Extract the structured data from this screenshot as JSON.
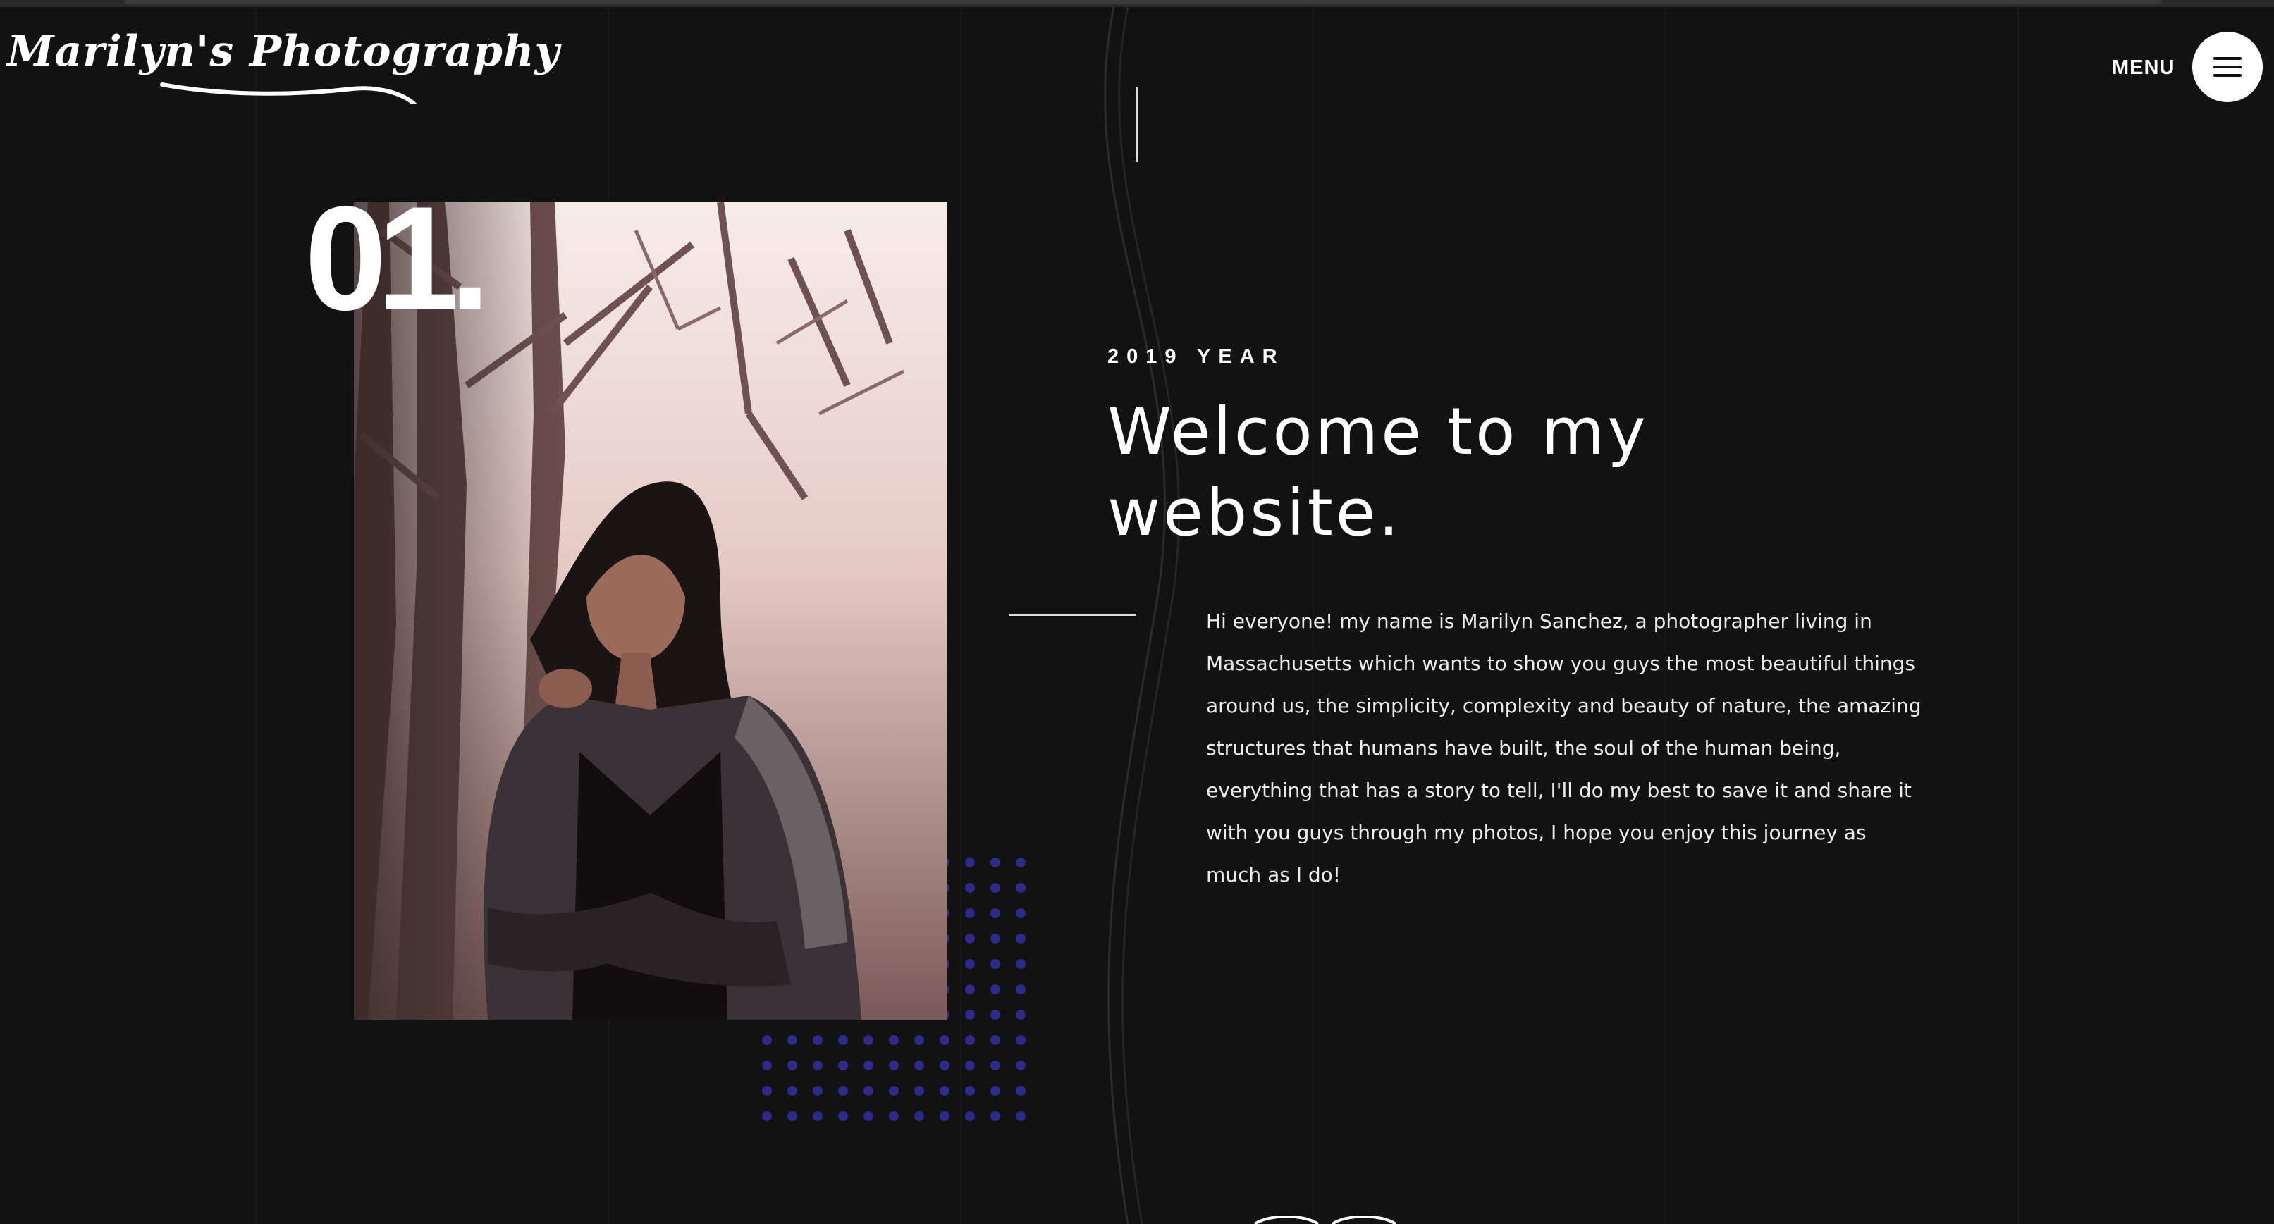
{
  "header": {
    "logo_text": "Marilyn's Photography",
    "menu_label": "MENU"
  },
  "section": {
    "number": "01.",
    "year_label": "2019 YEAR",
    "headline": "Welcome to my website.",
    "intro": "Hi everyone! my name is Marilyn Sanchez, a photographer living in Massachusetts which wants to show you guys the most beautiful things around us, the simplicity, complexity and beauty of nature, the amazing structures that humans have built, the soul of the human being, everything that has a story to tell, I'll do my best to save it and share it with you guys through my photos, I hope you enjoy this journey as much as I do!"
  },
  "colors": {
    "background": "#121212",
    "text": "#ffffff",
    "dot_accent": "#2e2a8c",
    "menu_button": "#ffffff"
  },
  "icons": {
    "menu": "hamburger-icon"
  }
}
